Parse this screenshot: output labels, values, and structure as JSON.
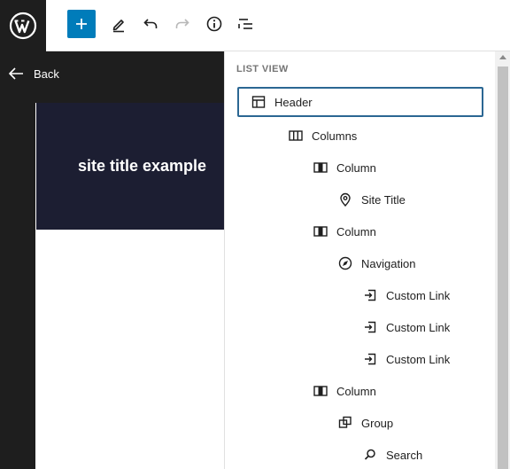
{
  "toolbar": {
    "logo": "wordpress-logo",
    "add_button": "add-block",
    "tools": [
      "pencil-icon",
      "undo-icon",
      "redo-icon",
      "info-icon",
      "list-view-icon"
    ],
    "accent": "#007cba"
  },
  "back": {
    "label": "Back"
  },
  "canvas": {
    "site_title": "site title example",
    "header_bg": "#1c1e32"
  },
  "list_view": {
    "title": "List View",
    "items": [
      {
        "label": "Header",
        "icon": "header-icon",
        "level": 0,
        "selected": true
      },
      {
        "label": "Columns",
        "icon": "columns-icon",
        "level": 1
      },
      {
        "label": "Column",
        "icon": "column-icon",
        "level": 2
      },
      {
        "label": "Site Title",
        "icon": "map-marker-icon",
        "level": 3
      },
      {
        "label": "Column",
        "icon": "column-icon",
        "level": 2
      },
      {
        "label": "Navigation",
        "icon": "navigation-icon",
        "level": 3
      },
      {
        "label": "Custom Link",
        "icon": "custom-link-icon",
        "level": 4
      },
      {
        "label": "Custom Link",
        "icon": "custom-link-icon",
        "level": 4
      },
      {
        "label": "Custom Link",
        "icon": "custom-link-icon",
        "level": 4
      },
      {
        "label": "Column",
        "icon": "column-icon",
        "level": 2
      },
      {
        "label": "Group",
        "icon": "group-icon",
        "level": 3
      },
      {
        "label": "Search",
        "icon": "search-icon",
        "level": 4
      }
    ]
  }
}
